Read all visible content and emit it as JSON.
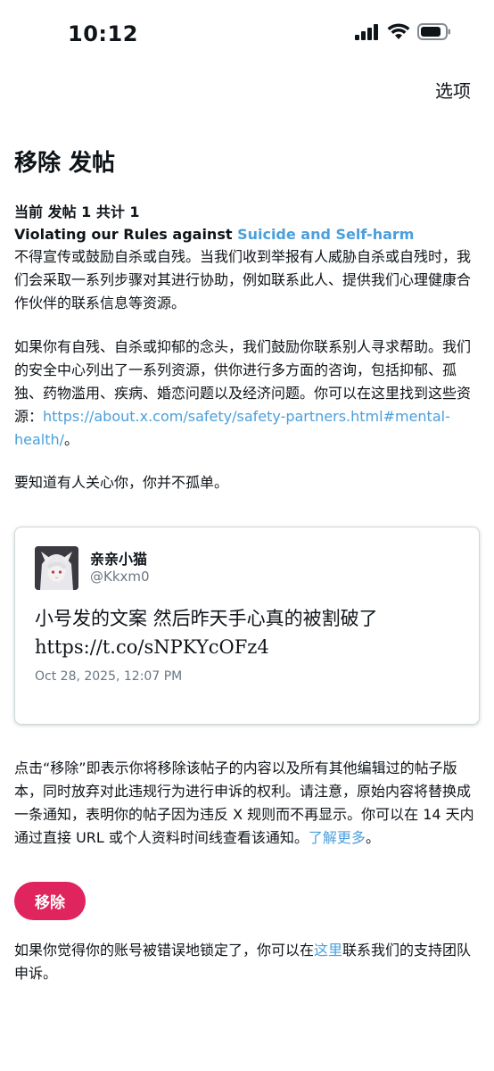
{
  "status_bar": {
    "time": "10:12",
    "icons": [
      "cellular-signal-icon",
      "wifi-icon",
      "battery-icon"
    ]
  },
  "nav": {
    "options_label": "选项"
  },
  "page_title": "移除 发帖",
  "current_count": "当前 发帖 1 共计 1",
  "rule": {
    "prefix": "Violating our Rules against ",
    "link_text": "Suicide and Self-harm"
  },
  "paragraphs": {
    "p1": "不得宣传或鼓励自杀或自残。当我们收到举报有人威胁自杀或自残时，我们会采取一系列步骤对其进行协助，例如联系此人、提供我们心理健康合作伙伴的联系信息等资源。",
    "p2_before": "如果你有自残、自杀或抑郁的念头，我们鼓励你联系别人寻求帮助。我们的安全中心列出了一系列资源，供你进行多方面的咨询，包括抑郁、孤独、药物滥用、疾病、婚恋问题以及经济问题。你可以在这里找到这些资源：",
    "p2_link": "https://about.x.com/safety/safety-partners.html#mental-health/",
    "p2_after": "。",
    "p3": "要知道有人关心你，你并不孤单。",
    "p4_text": "点击“移除”即表示你将移除该帖子的内容以及所有其他编辑过的帖子版本，同时放弃对此违规行为进行申诉的权利。请注意，原始内容将替换成一条通知，表明你的帖子因为违反 X 规则而不再显示。你可以在 14 天内通过直接 URL 或个人资料时间线查看该通知。",
    "p4_link": "了解更多",
    "p4_after": "。",
    "p5_before": "如果你觉得你的账号被错误地锁定了，你可以在",
    "p5_link": "这里",
    "p5_after": "联系我们的支持团队申诉。"
  },
  "tweet": {
    "author_name": "亲亲小猫",
    "author_handle": "@Kkxm0",
    "text_line1": "小号发的文案 然后昨天手心真的被割破了",
    "text_line2": "https://t.co/sNPKYcOFz4",
    "timestamp": "Oct 28, 2025, 12:07 PM"
  },
  "remove_button_label": "移除",
  "colors": {
    "link": "#4a9fdc",
    "remove_button": "#e0245e",
    "secondary_text": "#687684"
  }
}
